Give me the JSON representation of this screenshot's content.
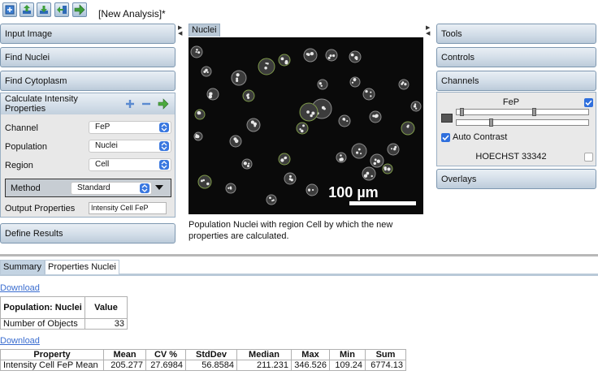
{
  "toolbar": {
    "doc_title": "[New Analysis]*",
    "buttons": [
      "new-analysis-icon",
      "upload-icon",
      "download-icon",
      "export-icon",
      "run-arrow-icon"
    ]
  },
  "left_panels": {
    "input_image": "Input Image",
    "find_nuclei": "Find Nuclei",
    "find_cytoplasm": "Find Cytoplasm",
    "calc": {
      "title": "Calculate Intensity Properties",
      "channel_label": "Channel",
      "channel_value": "FeP",
      "population_label": "Population",
      "population_value": "Nuclei",
      "region_label": "Region",
      "region_value": "Cell",
      "method_label": "Method",
      "method_value": "Standard",
      "output_label": "Output Properties",
      "output_value": "Intensity Cell FeP"
    },
    "define_results": "Define Results"
  },
  "viewer": {
    "tab_label": "Nuclei",
    "scale_bar_label": "100 µm",
    "caption": "Population Nuclei with region Cell by which the new properties are calculated."
  },
  "right_panels": {
    "tools": "Tools",
    "controls": "Controls",
    "channels": "Channels",
    "channel1_name": "FeP",
    "auto_contrast_label": "Auto Contrast",
    "channel2_name": "HOECHST 33342",
    "overlays": "Overlays"
  },
  "results": {
    "tabs": [
      "Summary",
      "Properties Nuclei"
    ],
    "download_label": "Download",
    "summary_table": {
      "headers": [
        "Population: Nuclei",
        "Value"
      ],
      "rows": [
        [
          "Number of Objects",
          "33"
        ]
      ]
    },
    "property_table": {
      "headers": [
        "Property",
        "Mean",
        "CV %",
        "StdDev",
        "Median",
        "Max",
        "Min",
        "Sum"
      ],
      "rows": [
        [
          "Intensity Cell FeP Mean",
          "205.277",
          "27.6984",
          "56.8584",
          "211.231",
          "346.526",
          "109.24",
          "6774.13"
        ]
      ]
    }
  },
  "colors": {
    "accent_blue": "#2f6fdd",
    "panel_header": "#d2dde8",
    "link": "#3b6ed0",
    "active_tab": "#c3d3e2"
  }
}
